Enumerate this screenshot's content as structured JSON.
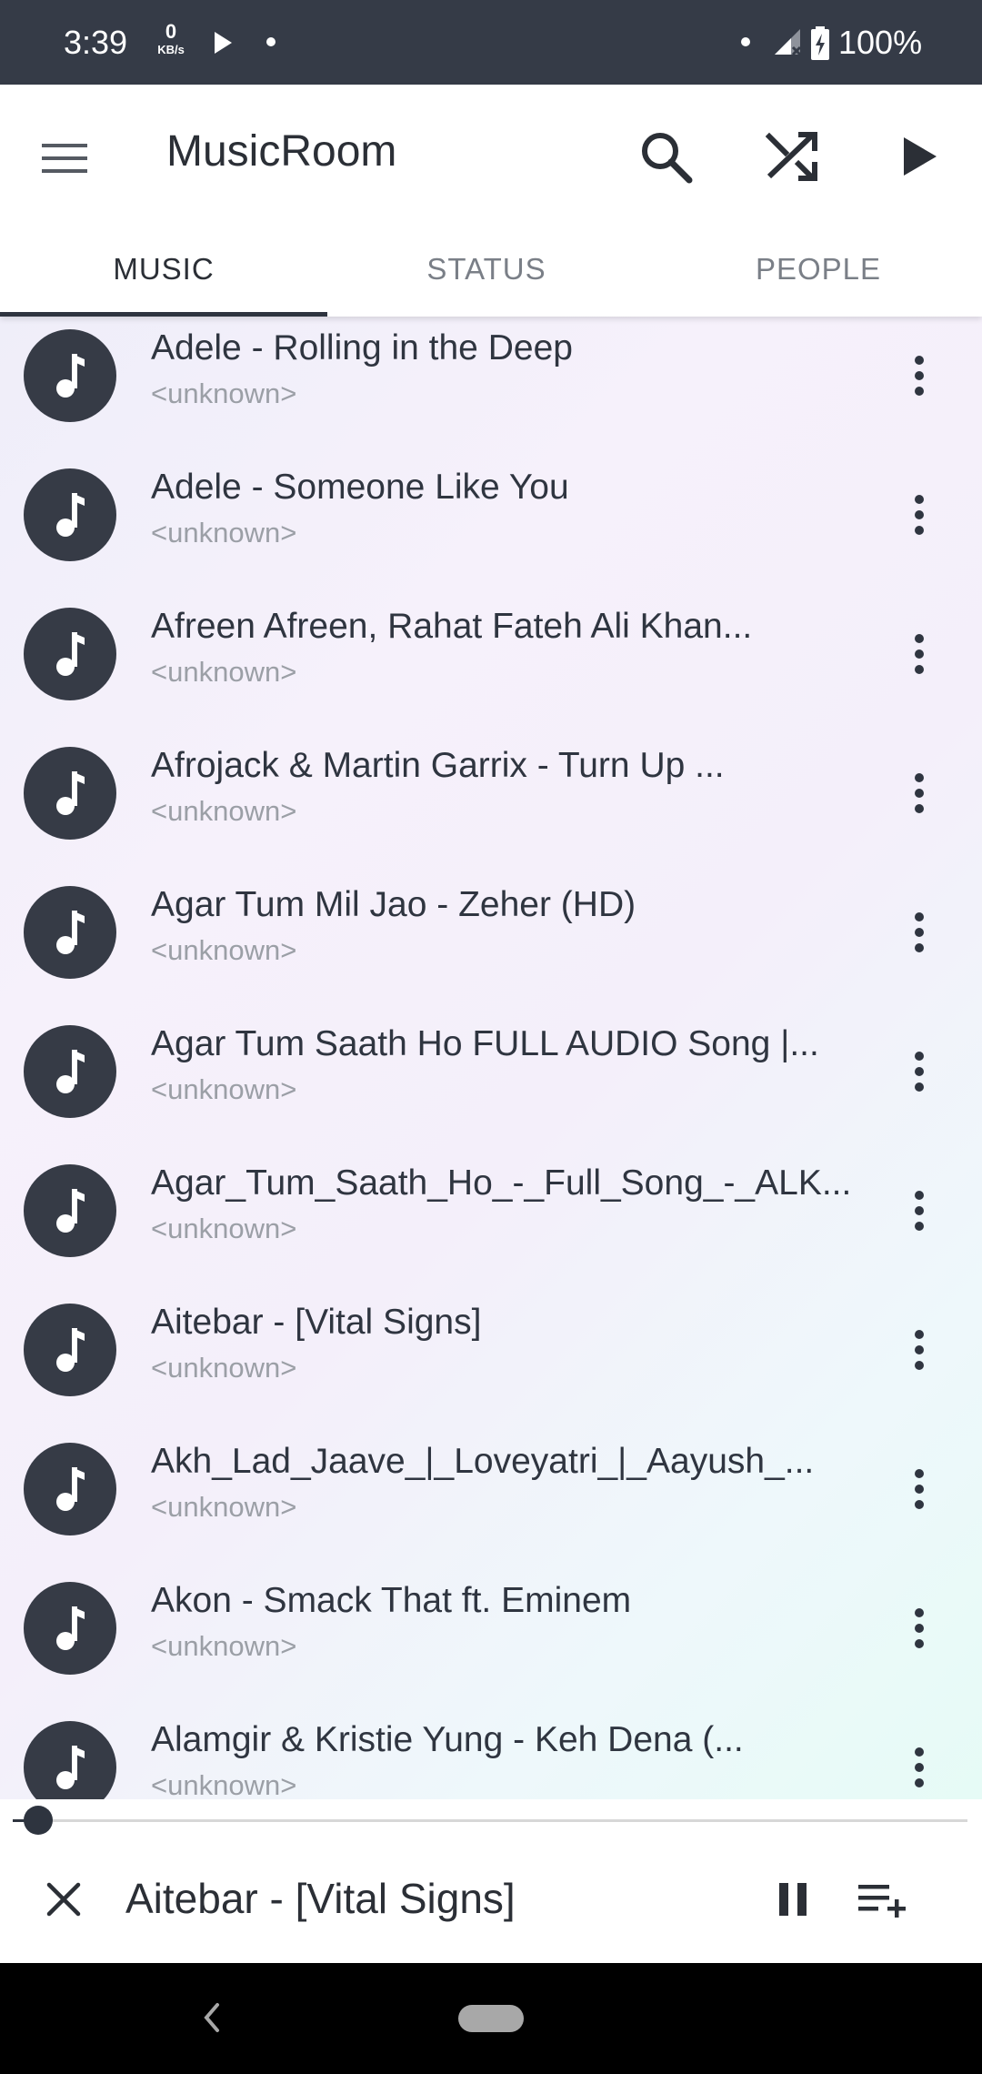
{
  "status_bar": {
    "time": "3:39",
    "net_speed_value": "0",
    "net_speed_unit": "KB/s",
    "battery": "100%"
  },
  "app_bar": {
    "title": "MusicRoom"
  },
  "tabs": [
    {
      "label": "MUSIC",
      "active": true
    },
    {
      "label": "STATUS",
      "active": false
    },
    {
      "label": "PEOPLE",
      "active": false
    }
  ],
  "songs": [
    {
      "title": "Adele - Rolling in the Deep",
      "artist": "<unknown>"
    },
    {
      "title": "Adele - Someone Like You",
      "artist": "<unknown>"
    },
    {
      "title": "Afreen Afreen, Rahat Fateh Ali Khan...",
      "artist": "<unknown>"
    },
    {
      "title": "Afrojack & Martin Garrix - Turn Up ...",
      "artist": "<unknown>"
    },
    {
      "title": "Agar Tum Mil Jao - Zeher (HD)",
      "artist": "<unknown>"
    },
    {
      "title": "Agar Tum Saath Ho FULL AUDIO Song |...",
      "artist": "<unknown>"
    },
    {
      "title": "Agar_Tum_Saath_Ho_-_Full_Song_-_ALK...",
      "artist": "<unknown>"
    },
    {
      "title": "Aitebar - [Vital Signs]",
      "artist": "<unknown>"
    },
    {
      "title": "Akh_Lad_Jaave_|_Loveyatri_|_Aayush_...",
      "artist": "<unknown>"
    },
    {
      "title": "Akon - Smack That ft. Eminem",
      "artist": "<unknown>"
    },
    {
      "title": "Alamgir & Kristie Yung - Keh Dena (...",
      "artist": "<unknown>"
    }
  ],
  "player": {
    "now_playing": "Aitebar - [Vital Signs]",
    "progress": 0.027
  },
  "colors": {
    "status_bar": "#353b47",
    "accent_dark": "#2e343f",
    "avatar_bg": "#363b46"
  }
}
